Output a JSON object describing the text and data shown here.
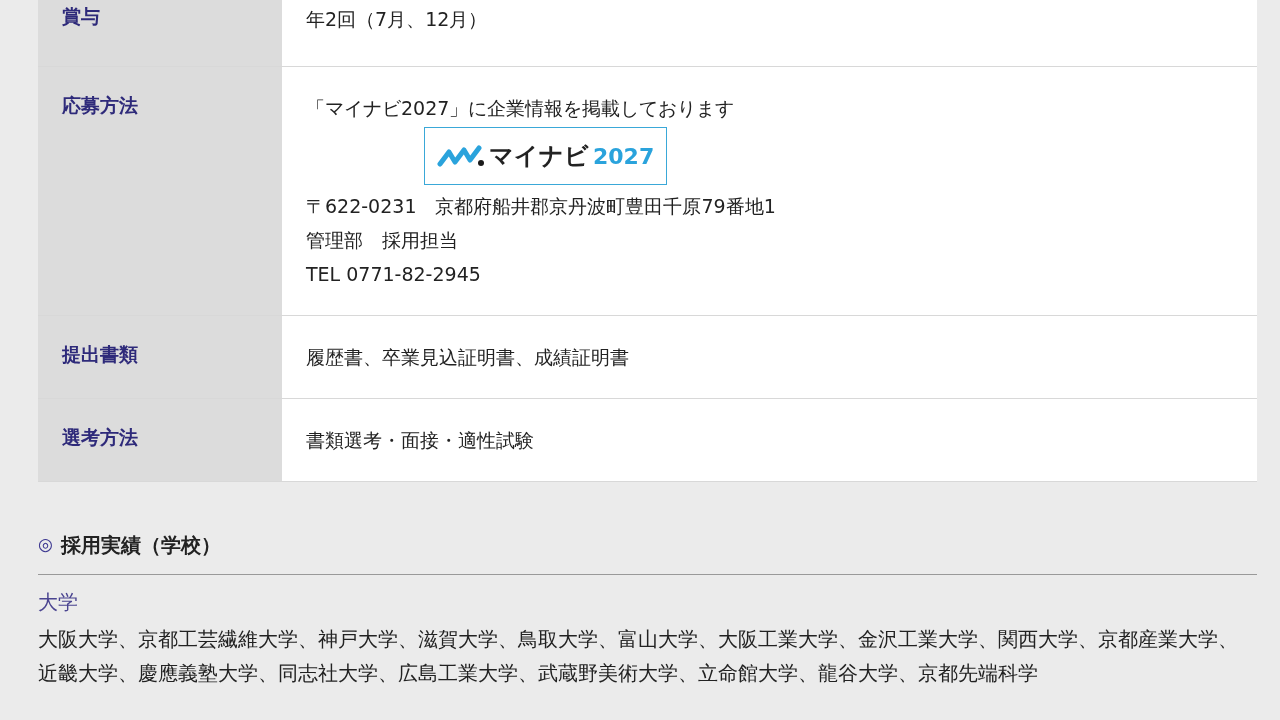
{
  "table": {
    "rows": [
      {
        "label": "賞与",
        "content": [
          {
            "kind": "text",
            "text": "年2回（7月、12月）"
          }
        ]
      },
      {
        "label": "応募方法",
        "content": [
          {
            "kind": "text",
            "text": "「マイナビ2027」に企業情報を掲載しております"
          },
          {
            "kind": "logo",
            "brand": "マイナビ",
            "year": "2027"
          },
          {
            "kind": "text",
            "text": "〒622-0231　京都府船井郡京丹波町豊田千原79番地1"
          },
          {
            "kind": "text",
            "text": "管理部　採用担当"
          },
          {
            "kind": "text",
            "text": "TEL 0771-82-2945"
          }
        ]
      },
      {
        "label": "提出書類",
        "content": [
          {
            "kind": "text",
            "text": "履歴書、卒業見込証明書、成績証明書"
          }
        ]
      },
      {
        "label": "選考方法",
        "content": [
          {
            "kind": "text",
            "text": "書類選考・面接・適性試験"
          }
        ]
      }
    ]
  },
  "section": {
    "mark": "◎",
    "title": "採用実績（学校）",
    "subheading": "大学",
    "text": "大阪大学、京都工芸繊維大学、神戸大学、滋賀大学、鳥取大学、富山大学、大阪工業大学、金沢工業大学、関西大学、京都産業大学、近畿大学、慶應義塾大学、同志社大学、広島工業大学、武蔵野美術大学、立命館大学、龍谷大学、京都先端科学"
  }
}
